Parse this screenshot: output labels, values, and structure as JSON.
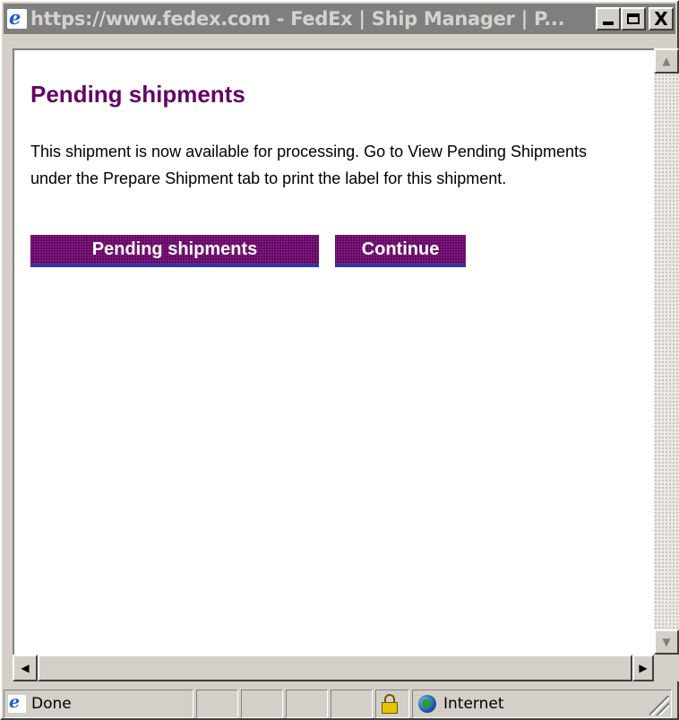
{
  "window": {
    "title": "https://www.fedex.com - FedEx | Ship Manager | P...",
    "minimize_label": "",
    "maximize_label": "",
    "close_label": "X"
  },
  "page": {
    "heading": "Pending shipments",
    "message": "This shipment is now available for processing. Go to View Pending Shipments under the Prepare Shipment tab to print the label for this shipment.",
    "buttons": {
      "pending_shipments": "Pending shipments",
      "continue": "Continue"
    }
  },
  "scrollbars": {
    "up_arrow": "▲",
    "down_arrow": "▼",
    "left_arrow": "◀",
    "right_arrow": "▶"
  },
  "statusbar": {
    "status_text": "Done",
    "zone_text": "Internet"
  },
  "icons": {
    "browser": "ie-icon",
    "lock": "padlock-icon",
    "zone": "globe-icon"
  },
  "colors": {
    "heading": "#660066",
    "button_bg": "#660066",
    "button_text": "#ffffff",
    "title_bar": "#7f7f7f"
  }
}
